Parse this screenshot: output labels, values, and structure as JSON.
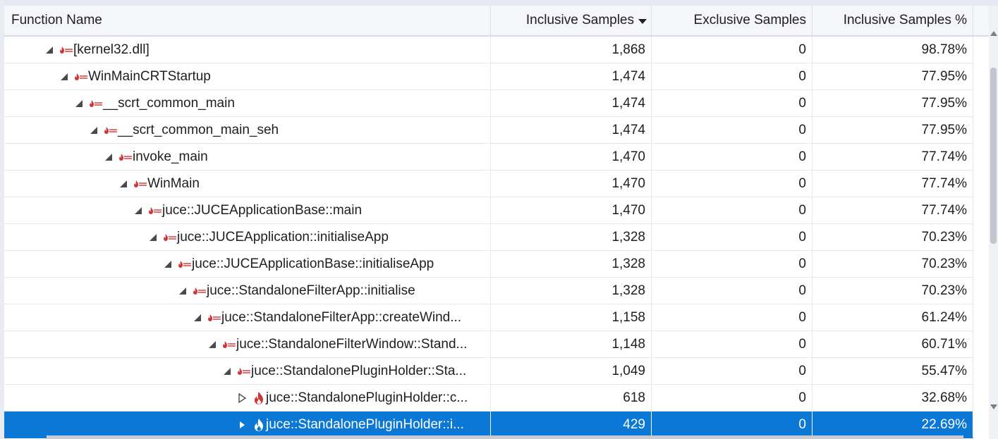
{
  "columns": {
    "name": "Function Name",
    "inclusive": "Inclusive Samples",
    "exclusive": "Exclusive Samples",
    "inclusive_pct": "Inclusive Samples %"
  },
  "rows": [
    {
      "name": "[kernel32.dll]",
      "inclusive": "1,868",
      "exclusive": "0",
      "pct": "98.78%",
      "depth": 0,
      "expander": "expanded",
      "icon": "hot-path-icon",
      "selected": false
    },
    {
      "name": "WinMainCRTStartup",
      "inclusive": "1,474",
      "exclusive": "0",
      "pct": "77.95%",
      "depth": 1,
      "expander": "expanded",
      "icon": "hot-path-icon",
      "selected": false
    },
    {
      "name": "__scrt_common_main",
      "inclusive": "1,474",
      "exclusive": "0",
      "pct": "77.95%",
      "depth": 2,
      "expander": "expanded",
      "icon": "hot-path-icon",
      "selected": false
    },
    {
      "name": "__scrt_common_main_seh",
      "inclusive": "1,474",
      "exclusive": "0",
      "pct": "77.95%",
      "depth": 3,
      "expander": "expanded",
      "icon": "hot-path-icon",
      "selected": false
    },
    {
      "name": "invoke_main",
      "inclusive": "1,470",
      "exclusive": "0",
      "pct": "77.74%",
      "depth": 4,
      "expander": "expanded",
      "icon": "hot-path-icon",
      "selected": false
    },
    {
      "name": "WinMain",
      "inclusive": "1,470",
      "exclusive": "0",
      "pct": "77.74%",
      "depth": 5,
      "expander": "expanded",
      "icon": "hot-path-icon",
      "selected": false
    },
    {
      "name": "juce::JUCEApplicationBase::main",
      "inclusive": "1,470",
      "exclusive": "0",
      "pct": "77.74%",
      "depth": 6,
      "expander": "expanded",
      "icon": "hot-path-icon",
      "selected": false
    },
    {
      "name": "juce::JUCEApplication::initialiseApp",
      "inclusive": "1,328",
      "exclusive": "0",
      "pct": "70.23%",
      "depth": 7,
      "expander": "expanded",
      "icon": "hot-path-icon",
      "selected": false
    },
    {
      "name": "juce::JUCEApplicationBase::initialiseApp",
      "inclusive": "1,328",
      "exclusive": "0",
      "pct": "70.23%",
      "depth": 8,
      "expander": "expanded",
      "icon": "hot-path-icon",
      "selected": false
    },
    {
      "name": "juce::StandaloneFilterApp::initialise",
      "inclusive": "1,328",
      "exclusive": "0",
      "pct": "70.23%",
      "depth": 9,
      "expander": "expanded",
      "icon": "hot-path-icon",
      "selected": false
    },
    {
      "name": "juce::StandaloneFilterApp::createWind...",
      "inclusive": "1,158",
      "exclusive": "0",
      "pct": "61.24%",
      "depth": 10,
      "expander": "expanded",
      "icon": "hot-path-icon",
      "selected": false
    },
    {
      "name": "juce::StandaloneFilterWindow::Stand...",
      "inclusive": "1,148",
      "exclusive": "0",
      "pct": "60.71%",
      "depth": 11,
      "expander": "expanded",
      "icon": "hot-path-icon",
      "selected": false
    },
    {
      "name": "juce::StandalonePluginHolder::Sta...",
      "inclusive": "1,049",
      "exclusive": "0",
      "pct": "55.47%",
      "depth": 12,
      "expander": "expanded",
      "icon": "hot-path-icon",
      "selected": false
    },
    {
      "name": "juce::StandalonePluginHolder::c...",
      "inclusive": "618",
      "exclusive": "0",
      "pct": "32.68%",
      "depth": 13,
      "expander": "collapsed",
      "icon": "flame-icon",
      "selected": false
    },
    {
      "name": "juce::StandalonePluginHolder::i...",
      "inclusive": "429",
      "exclusive": "0",
      "pct": "22.69%",
      "depth": 13,
      "expander": "collapsed-filled",
      "icon": "flame-icon",
      "selected": true
    }
  ],
  "colors": {
    "selection": "#0a78d4",
    "hot_icon": "#d13438",
    "header_bg": "#f5f6fa"
  }
}
